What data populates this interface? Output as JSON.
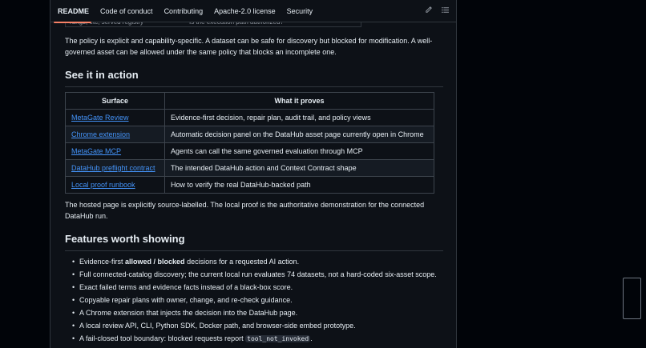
{
  "tabs": [
    {
      "label": "README",
      "active": true
    },
    {
      "label": "Code of conduct"
    },
    {
      "label": "Contributing"
    },
    {
      "label": "Apache-2.0 license"
    },
    {
      "label": "Security"
    }
  ],
  "icons": {
    "edit": "pencil-icon",
    "outline": "list-icon"
  },
  "remnant": {
    "left": "rungs, etc, served registry",
    "right": "Is the execution path authorized?"
  },
  "policy_paragraph": "The policy is explicit and capability-specific. A dataset can be safe for discovery but blocked for modification. A well-governed asset can be allowed under the same policy that blocks an incomplete one.",
  "see_in_action": {
    "heading": "See it in action",
    "columns": [
      "Surface",
      "What it proves"
    ],
    "rows": [
      {
        "surface": "MetaGate Review",
        "proves": "Evidence-first decision, repair plan, audit trail, and policy views"
      },
      {
        "surface": "Chrome extension",
        "proves": "Automatic decision panel on the DataHub asset page currently open in Chrome"
      },
      {
        "surface": "MetaGate MCP",
        "proves": "Agents can call the same governed evaluation through MCP"
      },
      {
        "surface": "DataHub preflight contract",
        "proves": "The intended DataHub action and Context Contract shape"
      },
      {
        "surface": "Local proof runbook",
        "proves": "How to verify the real DataHub-backed path"
      }
    ],
    "note": "The hosted page is explicitly source-labelled. The local proof is the authoritative demonstration for the connected DataHub run."
  },
  "features": {
    "heading": "Features worth showing",
    "items": [
      {
        "pre": "Evidence-first ",
        "bold": "allowed / blocked",
        "post": " decisions for a requested AI action."
      },
      {
        "pre": "Full connected-catalog discovery; the current local run evaluates 74 datasets, not a hard-coded six-asset scope."
      },
      {
        "pre": "Exact failed terms and evidence facts instead of a black-box score."
      },
      {
        "pre": "Copyable repair plans with owner, change, and re-check guidance."
      },
      {
        "pre": "A Chrome extension that injects the decision into the DataHub page."
      },
      {
        "pre": "A local review API, CLI, Python SDK, Docker path, and browser-side embed prototype."
      },
      {
        "pre": "A fail-closed tool boundary: blocked requests report ",
        "code": "tool_not_invoked",
        "post": "."
      }
    ]
  }
}
